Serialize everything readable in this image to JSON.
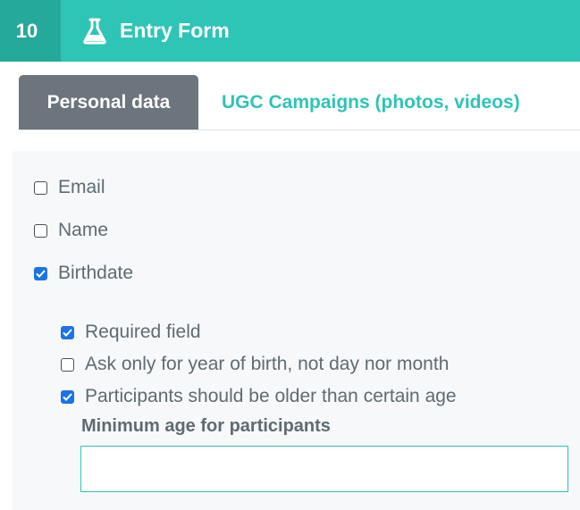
{
  "header": {
    "step_number": "10",
    "title": "Entry Form",
    "icon": "flask-icon",
    "bg_color": "#2ec4b6",
    "badge_color": "#25a99a"
  },
  "tabs": [
    {
      "label": "Personal data",
      "active": true
    },
    {
      "label": "UGC Campaigns (photos, videos)",
      "active": false
    }
  ],
  "fields": [
    {
      "label": "Email",
      "checked": false
    },
    {
      "label": "Name",
      "checked": false
    },
    {
      "label": "Birthdate",
      "checked": true
    }
  ],
  "birthdate_options": [
    {
      "label": "Required field",
      "checked": true
    },
    {
      "label": "Ask only for year of birth, not day nor month",
      "checked": false
    },
    {
      "label": "Participants should be older than certain age",
      "checked": true
    }
  ],
  "min_age": {
    "label": "Minimum age for participants",
    "value": "",
    "placeholder": ""
  },
  "colors": {
    "accent": "#2ec4b6",
    "checkbox_checked": "#1a73e8",
    "active_tab": "#6c757d"
  }
}
